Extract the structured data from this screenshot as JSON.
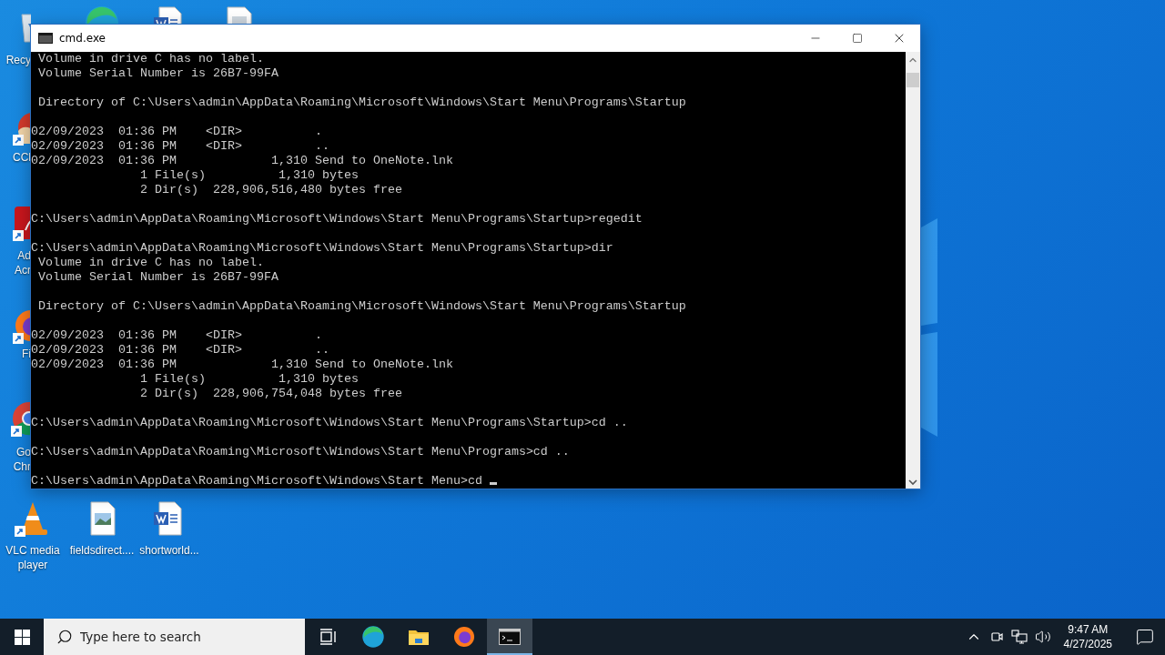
{
  "desktop_icons": [
    {
      "kind": "recycle-bin",
      "label": "Recy"
    },
    {
      "kind": "edge"
    },
    {
      "kind": "word"
    },
    {
      "kind": "document"
    },
    {
      "kind": "ccleaner",
      "label": "CCl"
    },
    {
      "kind": "acrobat",
      "label": "Ad\nAcr"
    },
    {
      "kind": "firefox",
      "label": "Fi"
    },
    {
      "kind": "chrome",
      "label": "Go\nChr"
    },
    {
      "kind": "vlc",
      "label": "VLC media player"
    },
    {
      "kind": "image",
      "label": "fieldsdirect...."
    },
    {
      "kind": "word",
      "label": "shortworld..."
    }
  ],
  "window": {
    "title": "cmd.exe",
    "console": {
      "cursor": true,
      "blocks": [
        [
          " Volume in drive C has no label.",
          " Volume Serial Number is 26B7-99FA"
        ],
        [
          " Directory of C:\\Users\\admin\\AppData\\Roaming\\Microsoft\\Windows\\Start Menu\\Programs\\Startup"
        ],
        [
          "02/09/2023  01:36 PM    <DIR>          .",
          "02/09/2023  01:36 PM    <DIR>          ..",
          "02/09/2023  01:36 PM             1,310 Send to OneNote.lnk",
          "               1 File(s)          1,310 bytes",
          "               2 Dir(s)  228,906,516,480 bytes free"
        ],
        [
          "C:\\Users\\admin\\AppData\\Roaming\\Microsoft\\Windows\\Start Menu\\Programs\\Startup>regedit"
        ],
        [
          "C:\\Users\\admin\\AppData\\Roaming\\Microsoft\\Windows\\Start Menu\\Programs\\Startup>dir",
          " Volume in drive C has no label.",
          " Volume Serial Number is 26B7-99FA"
        ],
        [
          " Directory of C:\\Users\\admin\\AppData\\Roaming\\Microsoft\\Windows\\Start Menu\\Programs\\Startup"
        ],
        [
          "02/09/2023  01:36 PM    <DIR>          .",
          "02/09/2023  01:36 PM    <DIR>          ..",
          "02/09/2023  01:36 PM             1,310 Send to OneNote.lnk",
          "               1 File(s)          1,310 bytes",
          "               2 Dir(s)  228,906,754,048 bytes free"
        ],
        [
          "C:\\Users\\admin\\AppData\\Roaming\\Microsoft\\Windows\\Start Menu\\Programs\\Startup>cd .."
        ],
        [
          "C:\\Users\\admin\\AppData\\Roaming\\Microsoft\\Windows\\Start Menu\\Programs>cd .."
        ],
        [
          "C:\\Users\\admin\\AppData\\Roaming\\Microsoft\\Windows\\Start Menu>cd "
        ]
      ]
    }
  },
  "taskbar": {
    "search": {
      "placeholder": "Type here to search"
    },
    "apps": [
      {
        "kind": "task-view",
        "selected": false
      },
      {
        "kind": "edge",
        "selected": false
      },
      {
        "kind": "explorer",
        "selected": false
      },
      {
        "kind": "firefox",
        "selected": false
      },
      {
        "kind": "terminal",
        "selected": true
      }
    ],
    "clock": {
      "time": "9:47 AM",
      "date": "4/27/2025"
    }
  }
}
